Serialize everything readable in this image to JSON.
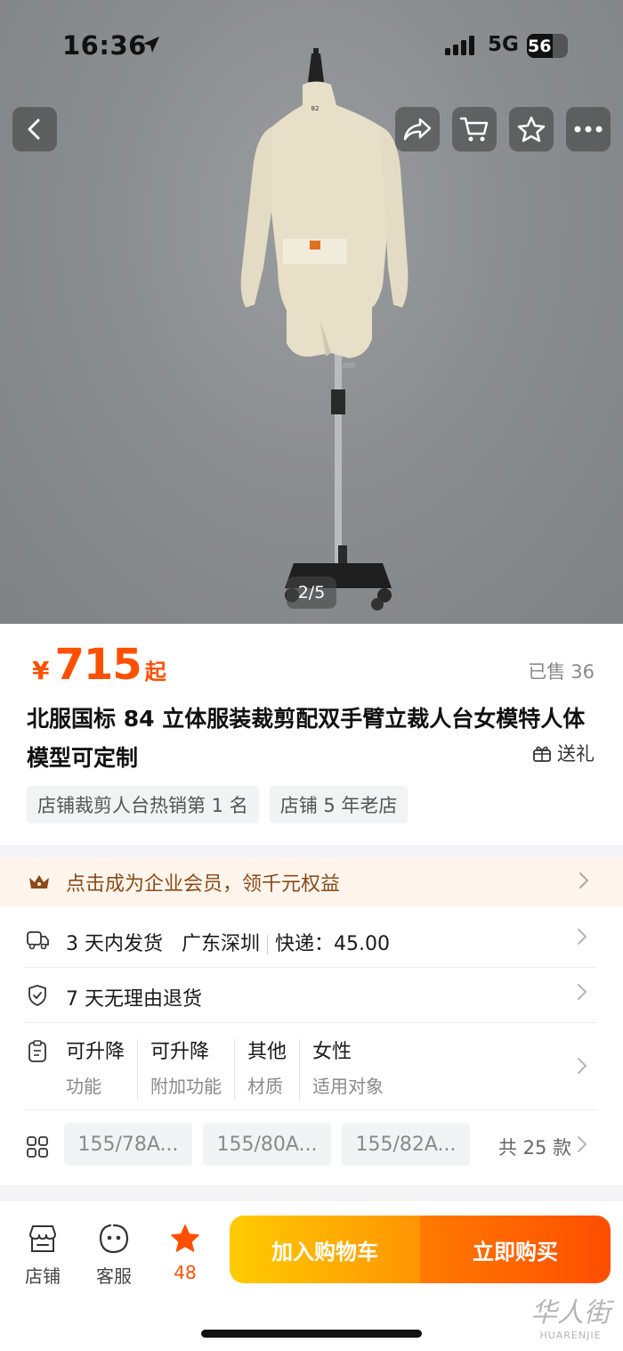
{
  "status_bar": {
    "time": "16:36",
    "network": "5G",
    "battery": "56"
  },
  "gallery": {
    "counter": "2/5",
    "mannequin_size_mark": "82"
  },
  "price": {
    "currency": "¥",
    "value": "715",
    "suffix": "起"
  },
  "sold": {
    "label": "已售",
    "count": "36"
  },
  "title": "北服国标 84 立体服装裁剪配双手臂立裁人台女模特人体模型可定制",
  "gift": "送礼",
  "tags": [
    "店铺裁剪人台热销第 1 名",
    "店铺 5 年老店"
  ],
  "member_banner": "点击成为企业会员，领千元权益",
  "shipping": {
    "time": "3 天内发货",
    "origin": "广东深圳",
    "fee": "快递：45.00"
  },
  "returns": "7 天无理由退货",
  "attributes": [
    {
      "value": "可升降",
      "key": "功能"
    },
    {
      "value": "可升降",
      "key": "附加功能"
    },
    {
      "value": "其他",
      "key": "材质"
    },
    {
      "value": "女性",
      "key": "适用对象"
    }
  ],
  "variants": {
    "options": [
      "155/78A...",
      "155/80A...",
      "155/82A..."
    ],
    "total": "共 25 款"
  },
  "bottom_bar": {
    "shop": "店铺",
    "service": "客服",
    "favorites": "48",
    "add_to_cart": "加入购物车",
    "buy_now": "立即购买"
  },
  "watermark": {
    "text_cn": "华人街",
    "text_en": "HUARENJIE"
  },
  "colors": {
    "accent": "#ff5000",
    "member_bg": "#fff5ec",
    "cart_btn": "#ffb000",
    "buy_btn": "#ff5a00"
  }
}
